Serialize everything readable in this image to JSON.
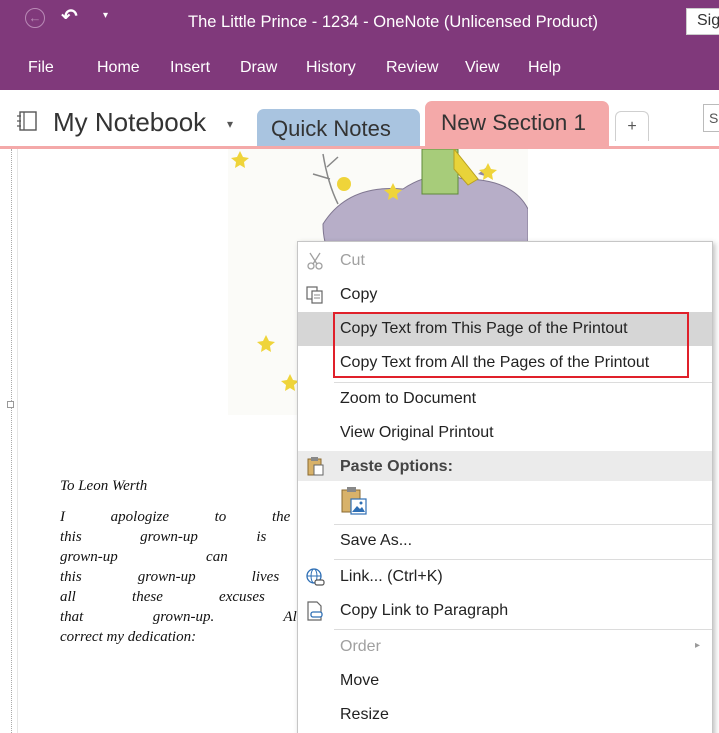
{
  "titlebar": {
    "title": "The Little Prince - 1234  -  OneNote (Unlicensed Product)",
    "signin_label": "Sig",
    "back_glyph": "←",
    "undo_glyph": "↶",
    "customize_glyph": "▾"
  },
  "menubar": {
    "items": [
      "File",
      "Home",
      "Insert",
      "Draw",
      "History",
      "Review",
      "View",
      "Help"
    ]
  },
  "notebook": {
    "name": "My Notebook",
    "caret": "▾",
    "tabs": [
      {
        "label": "Quick Notes",
        "color": "#a9c4e0"
      },
      {
        "label": "New Section 1",
        "color": "#f4a9a9",
        "active": true
      }
    ],
    "add_tab_glyph": "+",
    "search_placeholder": "Se"
  },
  "document": {
    "heading": "To Leon Werth",
    "lines": [
      "I apologize to the children for dedi",
      "this grown-up is the best friend",
      "grown-up can understand everythi",
      "this grown-up lives in France wh",
      "all these excuses are not enough,",
      "that grown-up. All grown-ups we",
      "correct my dedication:"
    ]
  },
  "context_menu": {
    "items": {
      "cut": {
        "label": "Cut",
        "icon": "scissors-icon",
        "disabled": true
      },
      "copy": {
        "label": "Copy",
        "icon": "copy-icon"
      },
      "copy_page_text": {
        "label": "Copy Text from This Page of the Printout"
      },
      "copy_all_text": {
        "label": "Copy Text from All the Pages of the Printout"
      },
      "zoom": {
        "label": "Zoom to Document"
      },
      "view_original": {
        "label": "View Original Printout"
      },
      "paste_header": {
        "label": "Paste Options:",
        "icon": "clipboard-icon"
      },
      "save_as": {
        "label": "Save As..."
      },
      "link": {
        "label": "Link...  (Ctrl+K)",
        "icon": "globe-link-icon"
      },
      "copy_link": {
        "label": "Copy Link to Paragraph",
        "icon": "page-link-icon"
      },
      "order": {
        "label": "Order",
        "disabled": true,
        "submenu_glyph": "▸"
      },
      "move": {
        "label": "Move"
      },
      "resize": {
        "label": "Resize"
      }
    },
    "highlight_color": "#e0202a"
  }
}
